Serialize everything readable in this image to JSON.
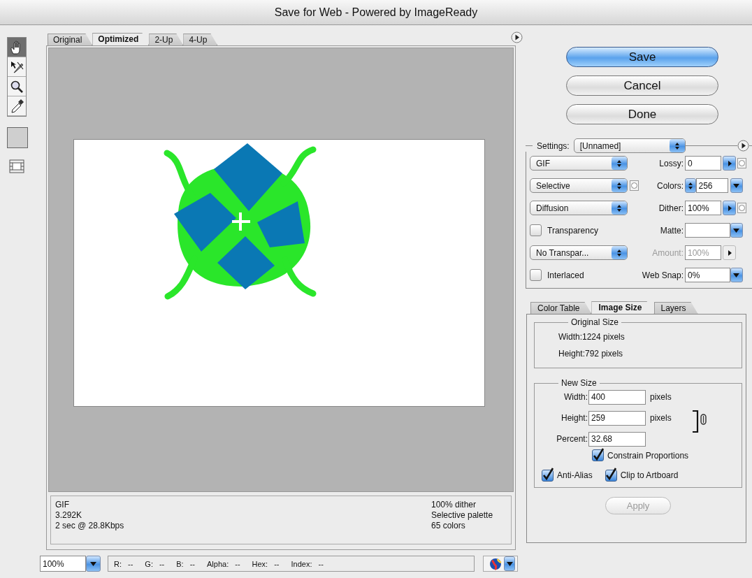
{
  "window": {
    "title": "Save for Web - Powered by ImageReady"
  },
  "tools": [
    {
      "kind": "hand",
      "selected": true
    },
    {
      "kind": "slice-select",
      "selected": false
    },
    {
      "kind": "zoom",
      "selected": false
    },
    {
      "kind": "eyedropper",
      "selected": false
    }
  ],
  "preview_tabs": [
    {
      "label": "Original",
      "selected": false
    },
    {
      "label": "Optimized",
      "selected": true
    },
    {
      "label": "2-Up",
      "selected": false
    },
    {
      "label": "4-Up",
      "selected": false
    }
  ],
  "info": {
    "left": [
      "GIF",
      "3.292K",
      "2 sec @ 28.8Kbps"
    ],
    "right": [
      "100% dither",
      "Selective palette",
      "65 colors"
    ]
  },
  "zoom_field": {
    "value": "100%"
  },
  "readout": [
    {
      "label": "R:",
      "value": "--"
    },
    {
      "label": "G:",
      "value": "--"
    },
    {
      "label": "B:",
      "value": "--"
    },
    {
      "label": "Alpha:",
      "value": "--"
    },
    {
      "label": "Hex:",
      "value": "--"
    },
    {
      "label": "Index:",
      "value": "--"
    }
  ],
  "buttons": [
    {
      "label": "Save",
      "kind": "default"
    },
    {
      "label": "Cancel",
      "kind": "normal"
    },
    {
      "label": "Done",
      "kind": "normal"
    }
  ],
  "settings": {
    "label": "Settings:",
    "preset": "[Unnamed]",
    "rows": [
      {
        "left": {
          "kind": "popup",
          "value": "GIF"
        },
        "right": {
          "label": "Lossy:",
          "kind": "field-arrow",
          "value": "0",
          "mask_button": true
        }
      },
      {
        "left": {
          "kind": "popup",
          "value": "Selective",
          "mask_button": true
        },
        "right": {
          "label": "Colors:",
          "kind": "stepper-field-menu",
          "value": "256"
        }
      },
      {
        "left": {
          "kind": "popup",
          "value": "Diffusion"
        },
        "right": {
          "label": "Dither:",
          "kind": "field-arrow",
          "value": "100%",
          "mask_button": true
        }
      },
      {
        "left": {
          "kind": "checkbox",
          "label": "Transparency",
          "checked": false
        },
        "right": {
          "label": "Matte:",
          "kind": "field-menu"
        }
      },
      {
        "left": {
          "kind": "popup",
          "value": "No Transpar..."
        },
        "right": {
          "label": "Amount:",
          "kind": "field-arrow",
          "value": "100%",
          "disabled": true
        }
      },
      {
        "left": {
          "kind": "checkbox",
          "label": "Interlaced",
          "checked": false
        },
        "right": {
          "label": "Web Snap:",
          "kind": "field-menu",
          "value": "0%"
        }
      }
    ]
  },
  "panel_tabs": [
    {
      "label": "Color Table",
      "selected": false
    },
    {
      "label": "Image Size",
      "selected": true
    },
    {
      "label": "Layers",
      "selected": false
    }
  ],
  "image_size": {
    "original_size": {
      "title": "Original Size",
      "lines": [
        "Width:1224 pixels",
        "Height:792 pixels"
      ]
    },
    "new_size": {
      "title": "New Size",
      "fields": [
        {
          "label": "Width:",
          "value": "400",
          "unit": "pixels"
        },
        {
          "label": "Height:",
          "value": "259",
          "unit": "pixels"
        },
        {
          "label": "Percent:",
          "value": "32.68"
        }
      ],
      "checkboxes": [
        {
          "label": "Constrain Proportions",
          "checked": true
        },
        {
          "label": "Anti-Alias",
          "checked": true
        },
        {
          "label": "Clip to Artboard",
          "checked": true
        }
      ]
    },
    "apply_button": {
      "label": "Apply",
      "disabled": true
    }
  }
}
